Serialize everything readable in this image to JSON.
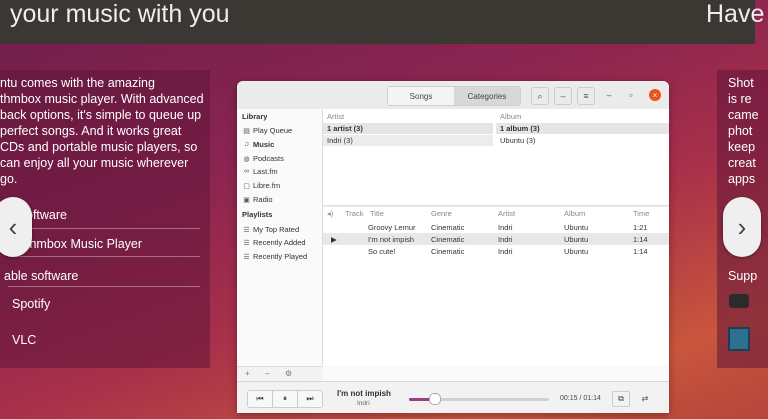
{
  "banner": {
    "left_text": "your music with you",
    "right_text": "Have"
  },
  "left_panel": {
    "description": "ntu comes with the amazing\nthmbox music player. With advanced\nback options, it's simple to queue up\nperfect songs. And it works great\nCDs and portable music players, so\ncan enjoy all your music wherever\ngo.",
    "included_heading": "oftware",
    "included_item": "thmbox Music Player",
    "available_heading": "able software",
    "available_items": [
      "Spotify",
      "VLC"
    ]
  },
  "right_panel": {
    "description": "Shot\nis re\ncame\nphot\nkeep\ncreat\napps",
    "support_heading": "Supp"
  },
  "nav": {
    "prev_icon": "‹",
    "next_icon": "›"
  },
  "app": {
    "tabs": [
      "Songs",
      "Categories"
    ],
    "active_tab": "Categories",
    "titlebar_icons": {
      "search": "⌕",
      "minimize": "–",
      "menu": "≡",
      "restore": "▫",
      "close": "×"
    },
    "sidebar": {
      "library_heading": "Library",
      "library_items": [
        "Play Queue",
        "Music",
        "Podcasts",
        "Last.fm",
        "Libre.fm",
        "Radio"
      ],
      "playlists_heading": "Playlists",
      "playlist_items": [
        "My Top Rated",
        "Recently Added",
        "Recently Played"
      ],
      "footer_buttons": [
        "+",
        "–",
        "⚙"
      ]
    },
    "browser": {
      "artist_header": "Artist",
      "album_header": "Album",
      "artist_rows": [
        "1 artist (3)",
        "Indri (3)"
      ],
      "album_rows": [
        "1 album (3)",
        "Ubuntu (3)"
      ]
    },
    "songs": {
      "headers": [
        "Track",
        "Title",
        "Genre",
        "Artist",
        "Album",
        "Time"
      ],
      "rows": [
        {
          "playing": "",
          "title": "Groovy Lemur",
          "genre": "Cinematic",
          "artist": "Indri",
          "album": "Ubuntu",
          "time": "1:21"
        },
        {
          "playing": "▶",
          "title": "I'm not impish",
          "genre": "Cinematic",
          "artist": "Indri",
          "album": "Ubuntu",
          "time": "1:14"
        },
        {
          "playing": "",
          "title": "So cute!",
          "genre": "Cinematic",
          "artist": "Indri",
          "album": "Ubuntu",
          "time": "1:14"
        }
      ]
    },
    "player": {
      "prev": "⏮",
      "pause": "⏸",
      "next": "⏭",
      "now_playing_title": "I'm not impish",
      "now_playing_artist": "Indri",
      "progress": 0.18,
      "time": "00:15 / 01:14",
      "repeat_icon": "⧉",
      "shuffle_icon": "⇄"
    }
  }
}
